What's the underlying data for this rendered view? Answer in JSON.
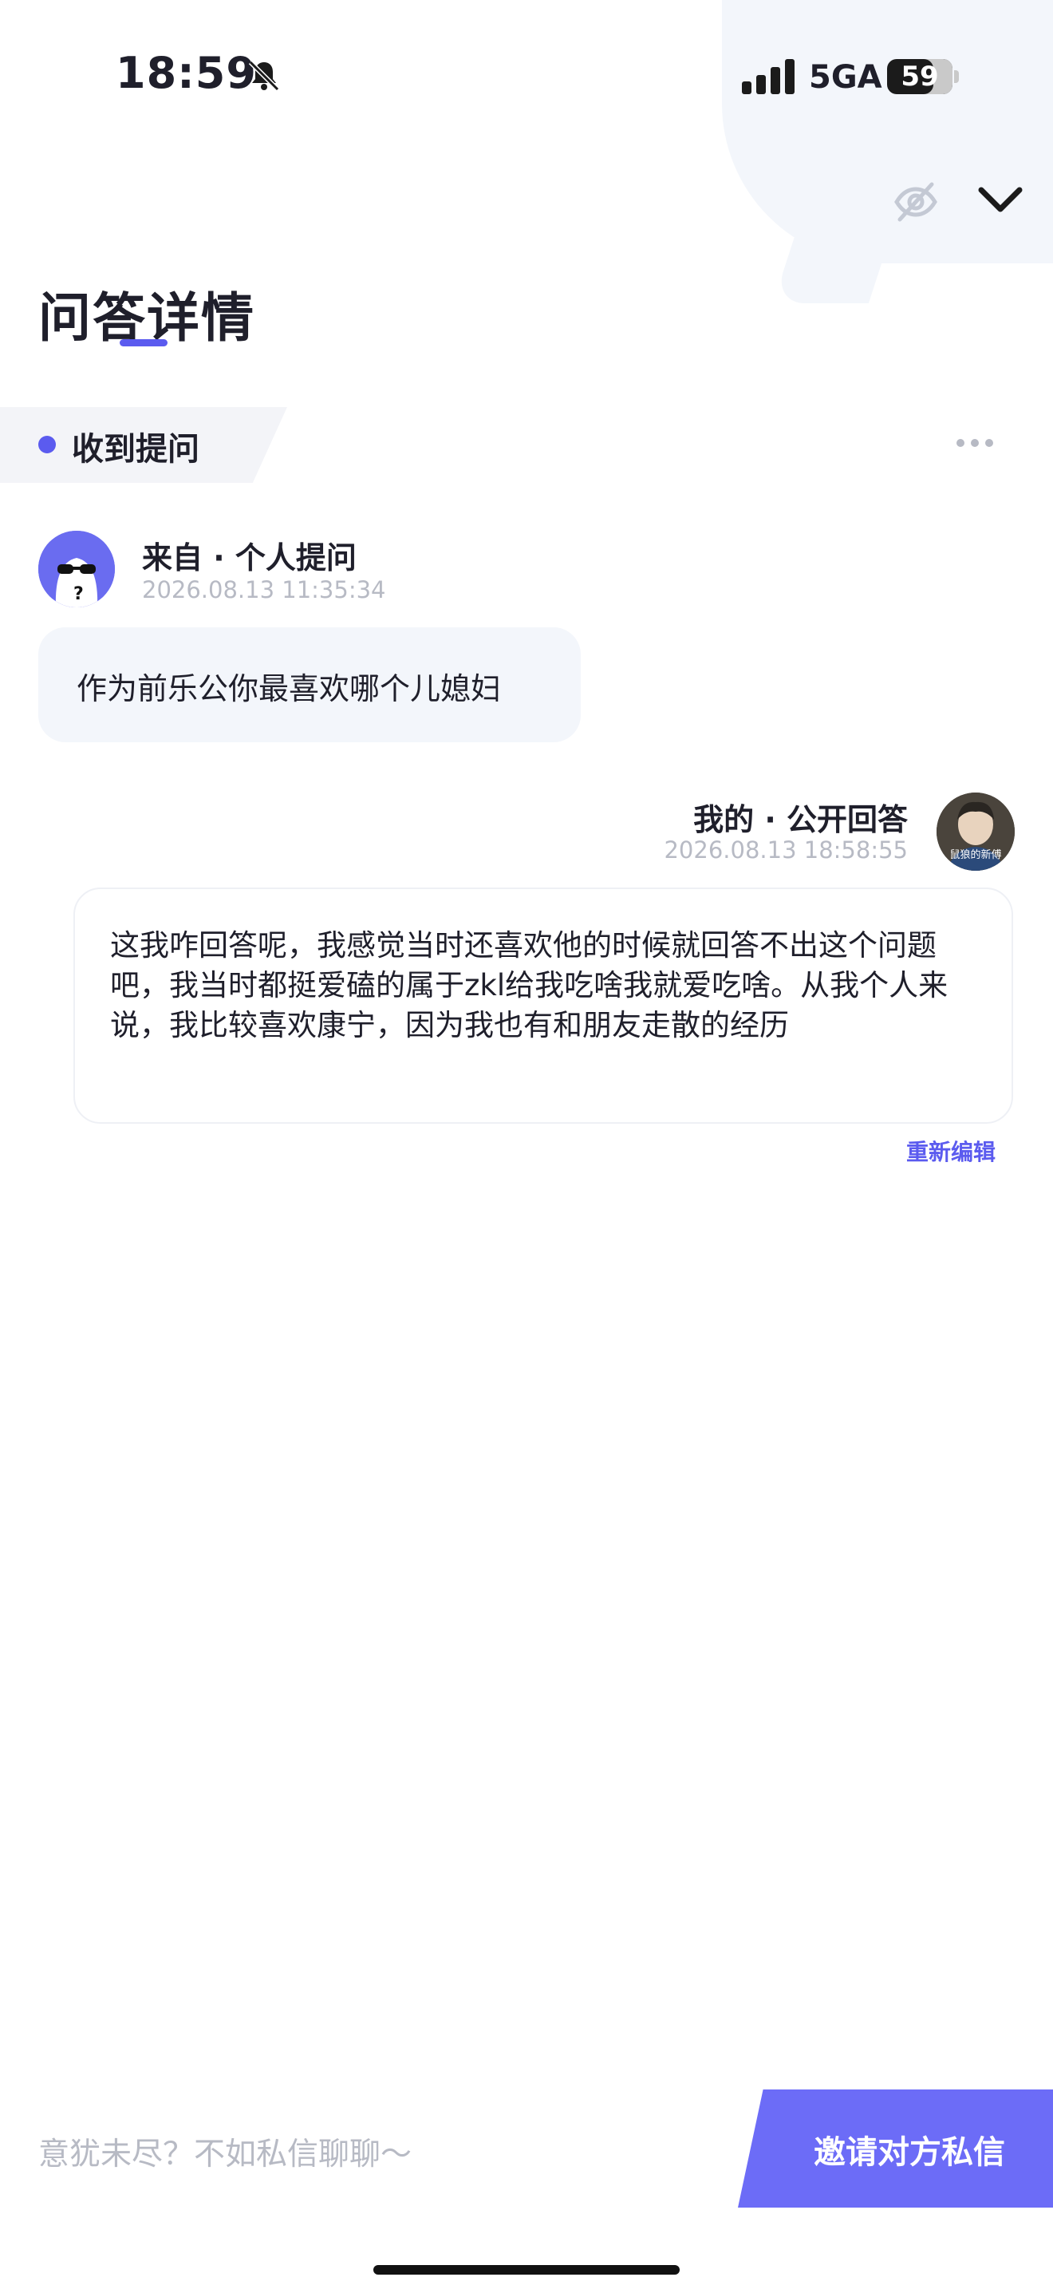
{
  "status_bar": {
    "time": "18:59",
    "network": "5GA",
    "battery": "59"
  },
  "page": {
    "title": "问答详情"
  },
  "section": {
    "label": "收到提问"
  },
  "question": {
    "from": "来自 · 个人提问",
    "time": "2026.08.13 11:35:34",
    "text": "作为前乐公你最喜欢哪个儿媳妇"
  },
  "answer": {
    "label": "我的 · 公开回答",
    "time": "2026.08.13 18:58:55",
    "text": "这我咋回答呢，我感觉当时还喜欢他的时候就回答不出这个问题吧，我当时都挺爱磕的属于zkl给我吃啥我就爱吃啥。从我个人来说，我比较喜欢康宁，因为我也有和朋友走散的经历",
    "edit_label": "重新编辑",
    "avatar_caption": "鼠狼的新傅"
  },
  "bottom": {
    "prompt": "意犹未尽？不如私信聊聊～",
    "invite_label": "邀请对方私信"
  },
  "colors": {
    "accent": "#5b5bef",
    "button": "#6c6cf7",
    "bubble_bg": "#f3f6fb",
    "muted_text": "#b7bac4"
  },
  "icons": [
    "bell-muted-icon",
    "signal-icon",
    "battery-icon",
    "hide-icon",
    "chevron-down-icon",
    "more-icon"
  ]
}
